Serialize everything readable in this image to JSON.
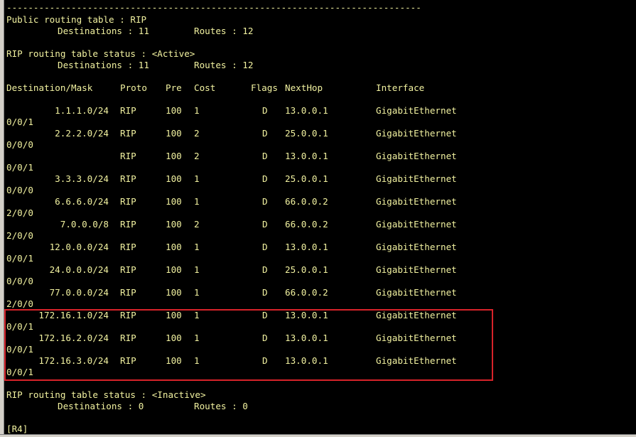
{
  "separator": "-----------------------------------------------------------------------------",
  "public_table": {
    "title": "Public routing table : RIP",
    "destinations_label": "Destinations : 11",
    "routes_label": "Routes : 12"
  },
  "active_status": {
    "title": "RIP routing table status : <Active>",
    "destinations_label": "Destinations : 11",
    "routes_label": "Routes : 12"
  },
  "table": {
    "headers": {
      "dest": "Destination/Mask",
      "proto": "Proto",
      "pre": "Pre",
      "cost": "Cost",
      "flags": "Flags",
      "nexthop": "NextHop",
      "iface": "Interface"
    },
    "rows": [
      {
        "dest": "1.1.1.0/24",
        "proto": "RIP",
        "pre": "100",
        "cost": "1",
        "flags": "D",
        "nexthop": "13.0.0.1",
        "iface": "GigabitEthernet",
        "iface_cont": "0/0/1"
      },
      {
        "dest": "2.2.2.0/24",
        "proto": "RIP",
        "pre": "100",
        "cost": "2",
        "flags": "D",
        "nexthop": "25.0.0.1",
        "iface": "GigabitEthernet",
        "iface_cont": "0/0/0"
      },
      {
        "dest": "",
        "proto": "RIP",
        "pre": "100",
        "cost": "2",
        "flags": "D",
        "nexthop": "13.0.0.1",
        "iface": "GigabitEthernet",
        "iface_cont": "0/0/1"
      },
      {
        "dest": "3.3.3.0/24",
        "proto": "RIP",
        "pre": "100",
        "cost": "1",
        "flags": "D",
        "nexthop": "25.0.0.1",
        "iface": "GigabitEthernet",
        "iface_cont": "0/0/0"
      },
      {
        "dest": "6.6.6.0/24",
        "proto": "RIP",
        "pre": "100",
        "cost": "1",
        "flags": "D",
        "nexthop": "66.0.0.2",
        "iface": "GigabitEthernet",
        "iface_cont": "2/0/0"
      },
      {
        "dest": "7.0.0.0/8",
        "proto": "RIP",
        "pre": "100",
        "cost": "2",
        "flags": "D",
        "nexthop": "66.0.0.2",
        "iface": "GigabitEthernet",
        "iface_cont": "2/0/0"
      },
      {
        "dest": "12.0.0.0/24",
        "proto": "RIP",
        "pre": "100",
        "cost": "1",
        "flags": "D",
        "nexthop": "13.0.0.1",
        "iface": "GigabitEthernet",
        "iface_cont": "0/0/1"
      },
      {
        "dest": "24.0.0.0/24",
        "proto": "RIP",
        "pre": "100",
        "cost": "1",
        "flags": "D",
        "nexthop": "25.0.0.1",
        "iface": "GigabitEthernet",
        "iface_cont": "0/0/0"
      },
      {
        "dest": "77.0.0.0/24",
        "proto": "RIP",
        "pre": "100",
        "cost": "1",
        "flags": "D",
        "nexthop": "66.0.0.2",
        "iface": "GigabitEthernet",
        "iface_cont": "2/0/0"
      },
      {
        "dest": "172.16.1.0/24",
        "proto": "RIP",
        "pre": "100",
        "cost": "1",
        "flags": "D",
        "nexthop": "13.0.0.1",
        "iface": "GigabitEthernet",
        "iface_cont": "0/0/1"
      },
      {
        "dest": "172.16.2.0/24",
        "proto": "RIP",
        "pre": "100",
        "cost": "1",
        "flags": "D",
        "nexthop": "13.0.0.1",
        "iface": "GigabitEthernet",
        "iface_cont": "0/0/1"
      },
      {
        "dest": "172.16.3.0/24",
        "proto": "RIP",
        "pre": "100",
        "cost": "1",
        "flags": "D",
        "nexthop": "13.0.0.1",
        "iface": "GigabitEthernet",
        "iface_cont": "0/0/1"
      }
    ]
  },
  "inactive_status": {
    "title": "RIP routing table status : <Inactive>",
    "destinations_label": "Destinations : 0",
    "routes_label": "Routes : 0"
  },
  "prompt": "[R4]",
  "colors": {
    "background": "#000000",
    "text": "#f2f2a0",
    "highlight": "#d8232a"
  }
}
